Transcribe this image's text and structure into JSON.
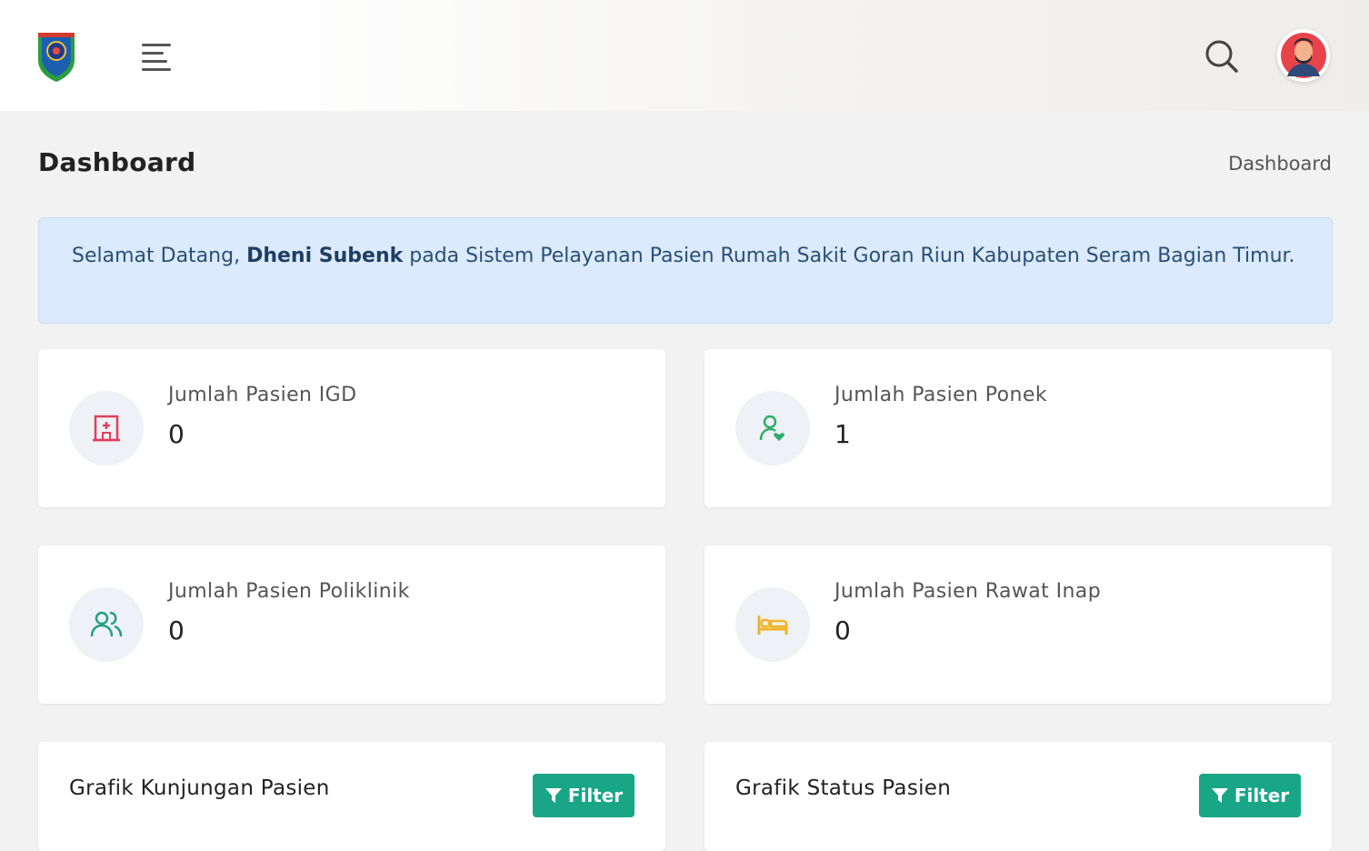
{
  "header": {
    "logo_icon": "regency-crest-logo",
    "menu_icon": "hamburger-menu-icon",
    "search_icon": "search-icon",
    "avatar_icon": "user-avatar"
  },
  "page": {
    "title": "Dashboard",
    "breadcrumb": "Dashboard"
  },
  "welcome": {
    "prefix": "Selamat Datang, ",
    "user_name": "Dheni Subenk",
    "suffix": " pada Sistem Pelayanan Pasien Rumah Sakit Goran Riun Kabupaten Seram Bagian Timur."
  },
  "stats": [
    {
      "label": "Jumlah Pasien IGD",
      "value": "0",
      "icon": "hospital-icon",
      "color": "#e0405d"
    },
    {
      "label": "Jumlah Pasien Ponek",
      "value": "1",
      "icon": "user-heart-icon",
      "color": "#2fae6a"
    },
    {
      "label": "Jumlah Pasien Poliklinik",
      "value": "0",
      "icon": "users-icon",
      "color": "#22a081"
    },
    {
      "label": "Jumlah Pasien Rawat Inap",
      "value": "0",
      "icon": "bed-icon",
      "color": "#f0b429"
    }
  ],
  "charts": [
    {
      "title": "Grafik Kunjungan Pasien",
      "filter_label": "Filter"
    },
    {
      "title": "Grafik Status Pasien",
      "filter_label": "Filter"
    }
  ],
  "colors": {
    "accent": "#19a686",
    "alert_bg": "#dbeafc",
    "alert_text": "#2a4f77"
  }
}
